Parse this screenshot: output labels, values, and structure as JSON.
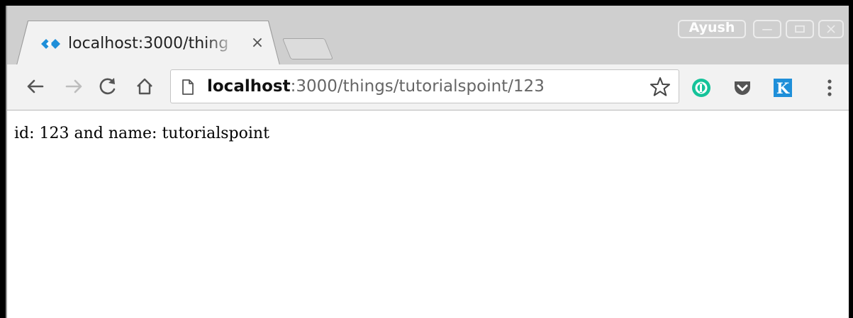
{
  "window": {
    "profile_name": "Ayush"
  },
  "tab": {
    "title": "localhost:3000/thing",
    "close_symbol": "×",
    "favicon": "expressjs-favicon-icon"
  },
  "toolbar": {
    "icons": [
      "back-arrow-icon",
      "forward-arrow-icon",
      "reload-icon",
      "home-icon"
    ],
    "address": {
      "host": "localhost",
      "rest": ":3000/things/tutorialspoint/123",
      "page_icon": "page-info-icon"
    },
    "bookmark_icon": "star-icon",
    "extensions": [
      {
        "name": "grammarly-icon",
        "color": "#15c39a"
      },
      {
        "name": "pocket-icon",
        "color": "#555555"
      },
      {
        "name": "k-extension-icon",
        "color": "#1f8fd9",
        "letter": "K"
      }
    ],
    "menu_icon": "vertical-dots-menu-icon"
  },
  "page": {
    "body_text": "id: 123 and name: tutorialspoint"
  },
  "colors": {
    "tabstrip": "#cfcfcf",
    "toolbar": "#f2f2f2",
    "favicon_blue": "#1f8fd9"
  }
}
